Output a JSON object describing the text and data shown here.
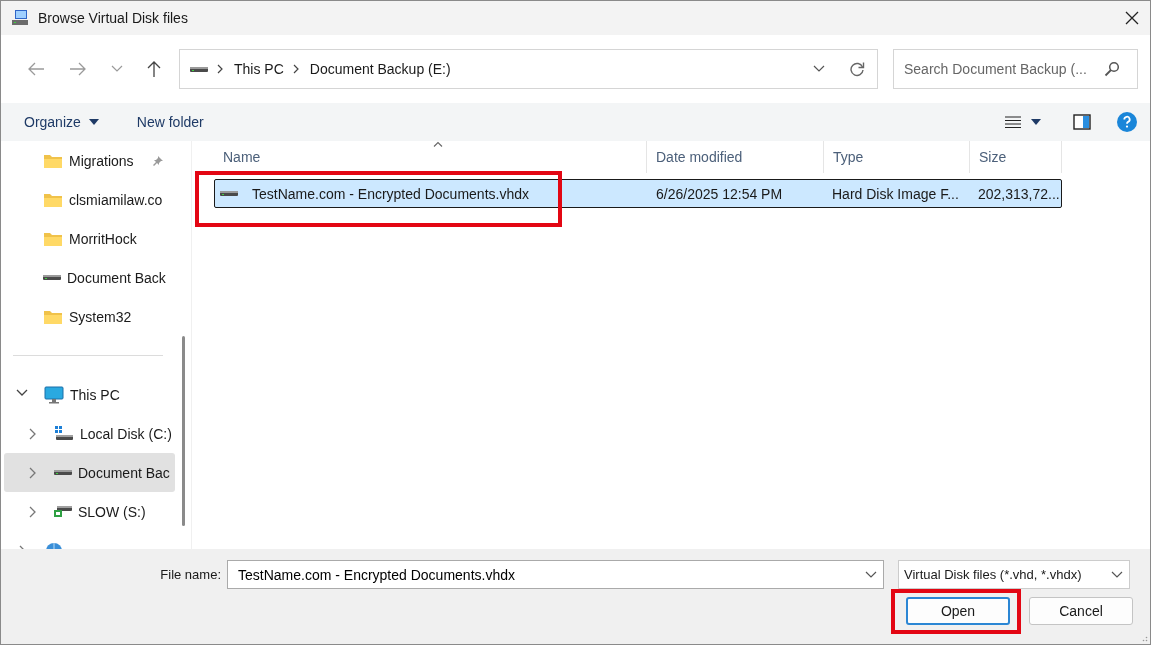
{
  "window": {
    "title": "Browse Virtual Disk files"
  },
  "address": {
    "crumbs": [
      "This PC",
      "Document Backup (E:)"
    ]
  },
  "search": {
    "placeholder": "Search Document Backup (..."
  },
  "toolbar": {
    "organize": "Organize",
    "new_folder": "New folder"
  },
  "sidebar": {
    "quick_access": [
      {
        "label": "Migrations",
        "kind": "folder",
        "pinned": true
      },
      {
        "label": "clsmiamilaw.co",
        "kind": "folder",
        "pinned": false
      },
      {
        "label": "MorritHock",
        "kind": "folder",
        "pinned": false
      },
      {
        "label": "Document Back",
        "kind": "drive",
        "pinned": false
      },
      {
        "label": "System32",
        "kind": "folder",
        "pinned": false
      }
    ],
    "tree": [
      {
        "label": "This PC",
        "kind": "pc",
        "expanded": true,
        "selected": false,
        "children": [
          {
            "label": "Local Disk (C:)",
            "kind": "windisk",
            "expanded": false,
            "selected": false
          },
          {
            "label": "Document Bac",
            "kind": "drive",
            "expanded": false,
            "selected": true
          },
          {
            "label": "SLOW (S:)",
            "kind": "netdrive",
            "expanded": false,
            "selected": false
          }
        ]
      },
      {
        "kind": "network",
        "expanded": false,
        "selected": false
      }
    ]
  },
  "table": {
    "columns": [
      {
        "label": "Name",
        "sorted": true
      },
      {
        "label": "Date modified",
        "sorted": false
      },
      {
        "label": "Type",
        "sorted": false
      },
      {
        "label": "Size",
        "sorted": false
      }
    ],
    "rows": [
      {
        "name": "TestName.com - Encrypted Documents.vhdx",
        "date": "6/26/2025 12:54 PM",
        "type": "Hard Disk Image F...",
        "size": "202,313,72...",
        "kind": "drive",
        "selected": true,
        "highlighted": true
      }
    ]
  },
  "footer": {
    "file_name_label": "File name:",
    "file_name": "TestName.com - Encrypted Documents.vhdx",
    "file_type": "Virtual Disk files (*.vhd, *.vhdx)",
    "buttons": [
      {
        "label": "Open",
        "default": true,
        "highlighted": true
      },
      {
        "label": "Cancel",
        "default": false,
        "highlighted": false
      }
    ]
  }
}
